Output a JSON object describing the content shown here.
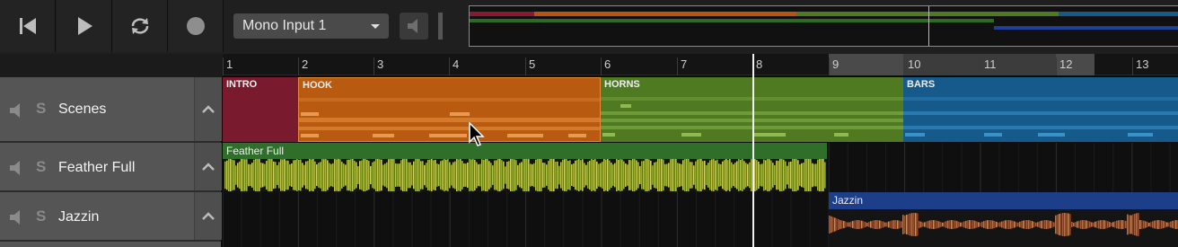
{
  "transport": {
    "prev_icon": "skip-back-icon",
    "play_icon": "play-icon",
    "loop_icon": "loop-icon",
    "record_icon": "record-icon"
  },
  "input": {
    "selected": "Mono Input 1"
  },
  "ruler": {
    "bars": [
      "1",
      "2",
      "3",
      "4",
      "5",
      "6",
      "7",
      "8",
      "9",
      "10",
      "11",
      "12",
      "13"
    ]
  },
  "scenes": {
    "track_name": "Scenes",
    "items": [
      {
        "label": "INTRO",
        "color": "#7a1a2e"
      },
      {
        "label": "HOOK",
        "color": "#b85a10"
      },
      {
        "label": "HORNS",
        "color": "#4f7a22"
      },
      {
        "label": "BARS",
        "color": "#155a8a"
      }
    ]
  },
  "tracks": [
    {
      "name": "Feather Full",
      "clip_label": "Feather Full",
      "color": "#2f6f2a"
    },
    {
      "name": "Jazzin",
      "clip_label": "Jazzin",
      "color": "#1d3f8a"
    }
  ],
  "solo_label": "S"
}
